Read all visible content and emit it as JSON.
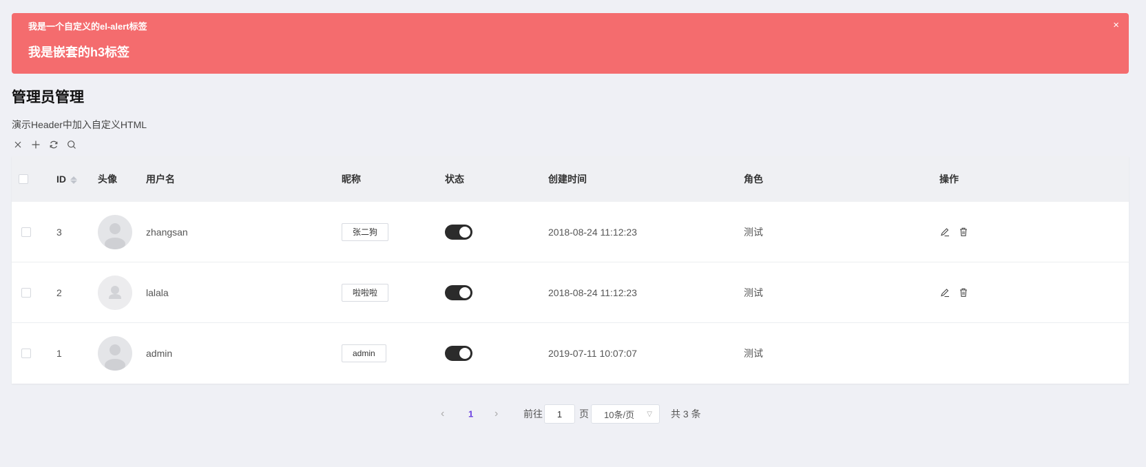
{
  "alert": {
    "title": "我是一个自定义的el-alert标签",
    "h3": "我是嵌套的h3标签",
    "close_icon": "×"
  },
  "page": {
    "title": "管理员管理",
    "subtitle": "演示Header中加入自定义HTML"
  },
  "toolbar": {
    "icons": [
      "close-icon",
      "plus-icon",
      "refresh-icon",
      "search-icon"
    ]
  },
  "table": {
    "headers": {
      "id": "ID",
      "avatar": "头像",
      "username": "用户名",
      "nickname": "昵称",
      "status": "状态",
      "created": "创建时间",
      "role": "角色",
      "actions": "操作"
    },
    "rows": [
      {
        "id": "3",
        "avatar_icon": "user-avatar-icon",
        "username": "zhangsan",
        "nickname": "张二狗",
        "status_on": true,
        "created": "2018-08-24 11:12:23",
        "role": "测试",
        "has_actions": true
      },
      {
        "id": "2",
        "avatar_icon": "user-avatar-icon",
        "username": "lalala",
        "nickname": "啦啦啦",
        "status_on": true,
        "created": "2018-08-24 11:12:23",
        "role": "测试",
        "has_actions": true
      },
      {
        "id": "1",
        "avatar_icon": "user-avatar-icon",
        "username": "admin",
        "nickname": "admin",
        "status_on": true,
        "created": "2019-07-11 10:07:07",
        "role": "测试",
        "has_actions": false
      }
    ]
  },
  "pagination": {
    "prev_icon": "‹",
    "current_page": "1",
    "next_icon": "›",
    "goto_label": "前往",
    "goto_value": "1",
    "page_suffix": "页",
    "page_size": "10条/页",
    "total": "共 3 条"
  },
  "colors": {
    "alert_bg": "#f46c6e",
    "switch_on": "#2b2b2b",
    "page_active": "#6a3fe0"
  }
}
